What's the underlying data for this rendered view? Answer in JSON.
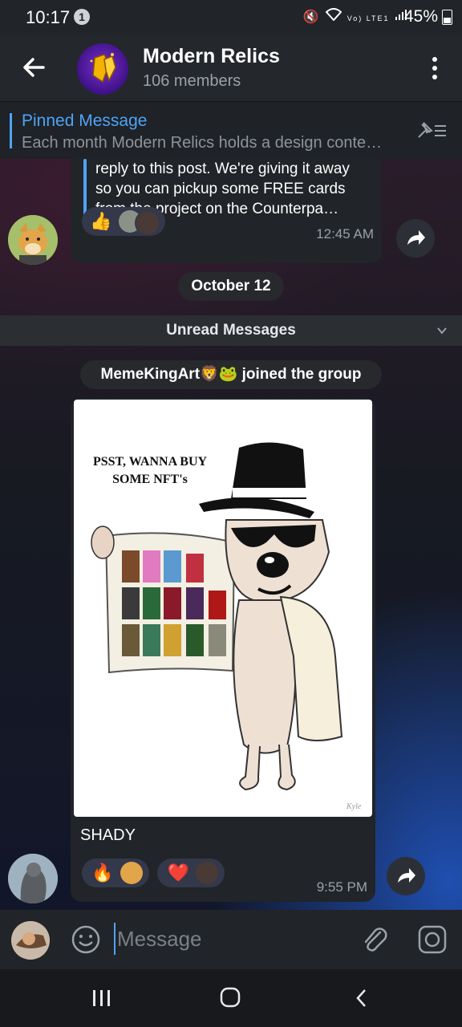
{
  "statusbar": {
    "time": "10:17",
    "notification_count": "1",
    "battery": "45%",
    "signal_text": "Vo) LTE1"
  },
  "header": {
    "title": "Modern Relics",
    "subtitle": "106 members"
  },
  "pinned": {
    "title": "Pinned Message",
    "text": "Each month Modern Relics holds a design conte…"
  },
  "message1": {
    "lines": [
      "reply to this post. We're giving it away",
      "so you can pickup some FREE cards",
      "from the project on the Counterpa…"
    ],
    "reactions": [
      "👍"
    ],
    "time": "12:45 AM"
  },
  "date_chip": "October 12",
  "unread_label": "Unread Messages",
  "joined": {
    "name": "MemeKingArt",
    "emojis": "🦁🐸",
    "text": "joined the group"
  },
  "message2": {
    "image_text_line1": "PSST, WANNA BUY",
    "image_text_line2": "SOME NFT's",
    "image_signature": "Kyle",
    "caption": "SHADY",
    "reactions": [
      "🔥",
      "❤️"
    ],
    "time": "9:55 PM"
  },
  "input": {
    "placeholder": "Message"
  },
  "colors": {
    "accent": "#4ea4f6",
    "bubble": "#212428",
    "background": "#1c1f24"
  }
}
